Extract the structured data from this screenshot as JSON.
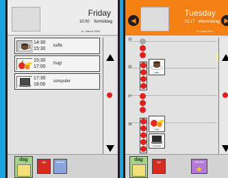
{
  "screen1": {
    "day": "Friday",
    "time": "10:00",
    "period": "formiddag",
    "date": "11. March 2009",
    "items": [
      {
        "start": "14:30",
        "end": "15:30",
        "label": "kaffe",
        "icon": "coffee-cup-icon"
      },
      {
        "start": "15:30",
        "end": "17:00",
        "label": "frugt",
        "icon": "fruit-icon"
      },
      {
        "start": "17:30",
        "end": "18:00",
        "label": "computer",
        "icon": "laptop-icon"
      }
    ],
    "tabs": {
      "dag": "dag",
      "uge": "uge",
      "maned": "måned"
    }
  },
  "screen2": {
    "day": "Tuesday",
    "time": "15:17",
    "period": "eftermiddag",
    "date": "13. April 2010",
    "hours": [
      "15",
      "16",
      "17",
      "18"
    ],
    "events": [
      {
        "label": "kaffe",
        "icon": "coffee-cup-icon"
      },
      {
        "label": "frugt",
        "icon": "fruit-icon"
      },
      {
        "label": "computer",
        "icon": "laptop-icon"
      }
    ],
    "tabs": {
      "dag": "dag",
      "uge": "uge",
      "aktivitet": "aktivitet"
    }
  },
  "colors": {
    "background": "#1aa3dd",
    "header_orange": "#f47f12",
    "dot_red": "#e0201e",
    "tab_green": "#a4d28a"
  }
}
